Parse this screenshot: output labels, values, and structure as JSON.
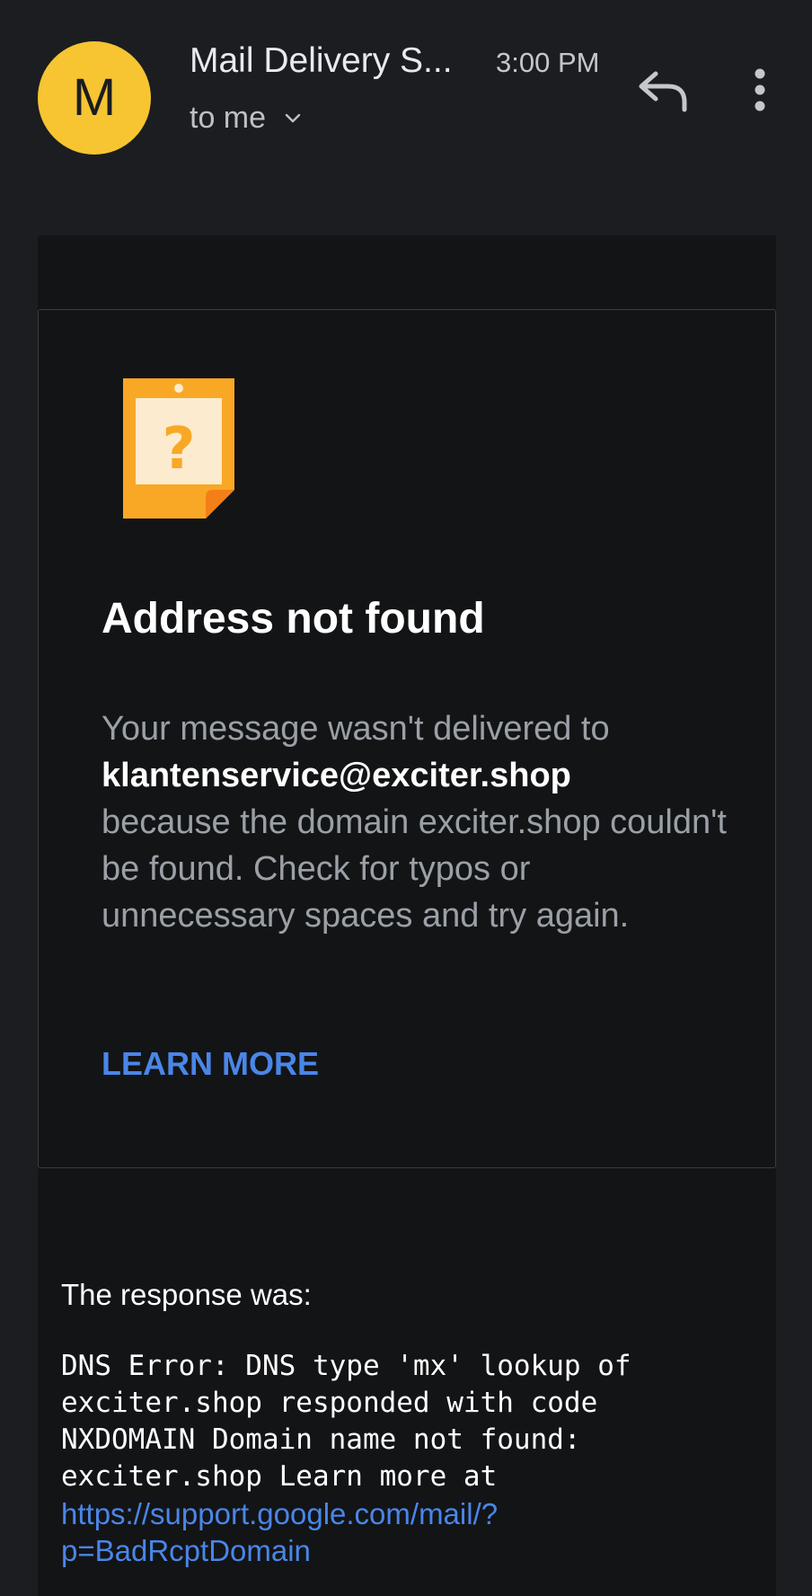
{
  "header": {
    "avatar_letter": "M",
    "sender": "Mail Delivery S...",
    "time": "3:00 PM",
    "recipient": "to me",
    "avatar_color": "#f6c531"
  },
  "card": {
    "title": "Address not found",
    "text_before": "Your message wasn't delivered to",
    "address": "klantenservice@exciter.shop",
    "text_after": "because the domain exciter.shop couldn't be found. Check for typos or unnecessary spaces and try again.",
    "learn_more": "LEARN MORE",
    "icon": "question-note-icon"
  },
  "response": {
    "label": "The response was:",
    "code_lines": [
      "DNS Error: DNS type 'mx' lookup of",
      "exciter.shop responded with code",
      "NXDOMAIN Domain name not found:",
      "exciter.shop Learn more at"
    ],
    "link_lines": [
      "https://support.google.com/mail/?",
      "p=BadRcptDomain"
    ]
  },
  "colors": {
    "background": "#1b1d20",
    "message_background": "#131416",
    "link": "#4a86e8",
    "note_orange": "#f9a825"
  }
}
